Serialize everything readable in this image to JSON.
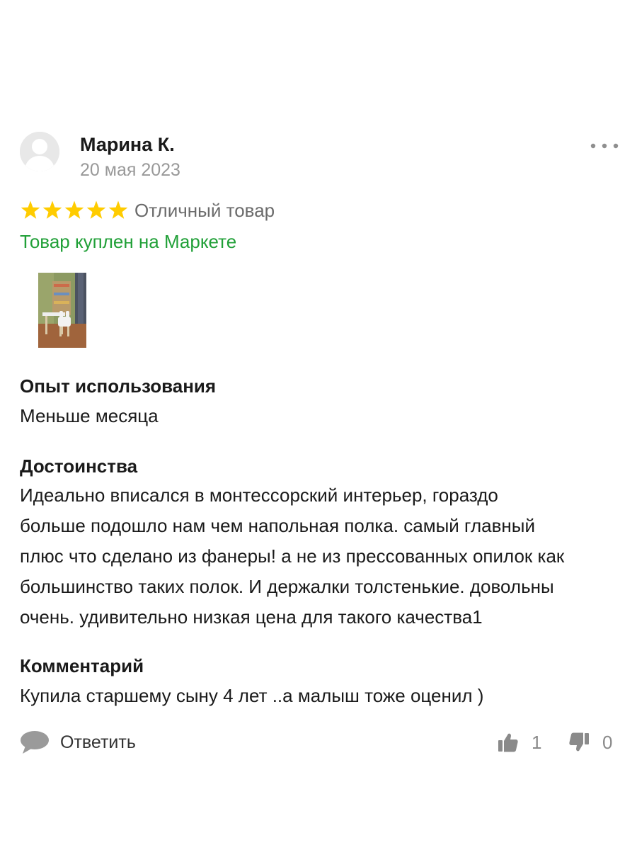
{
  "author": {
    "name": "Марина К.",
    "date": "20 мая 2023"
  },
  "rating": {
    "stars": 5,
    "max_stars": 5,
    "label": "Отличный товар",
    "star_color": "#FFCC00"
  },
  "purchase_badge": {
    "label": "Товар куплен на Маркете",
    "color": "#21A038"
  },
  "photos": [
    {
      "description": "photo"
    }
  ],
  "sections": {
    "experience": {
      "title": "Опыт использования",
      "text": "Меньше месяца"
    },
    "pros": {
      "title": "Достоинства",
      "lines": [
        "Идеально вписался в монтессорский интерьер, гораздо",
        "больше подошло нам чем напольная полка. самый главный",
        "плюс что сделано из фанеры! а не из прессованных опилок как",
        "большинство таких полок. И держалки толстенькие. довольны",
        "очень. удивительно низкая цена для такого качества1"
      ]
    },
    "comment": {
      "title": "Комментарий",
      "text": "Купила старшему сыну 4 лет ..а малыш тоже оценил )"
    }
  },
  "actions": {
    "reply_label": "Ответить",
    "likes": "1",
    "dislikes": "0"
  },
  "icons": {
    "more": "more-dots-icon",
    "reply": "speech-bubble-icon",
    "like": "thumbs-up-icon",
    "dislike": "thumbs-down-icon",
    "avatar": "user-silhouette-icon",
    "star": "star-icon"
  }
}
